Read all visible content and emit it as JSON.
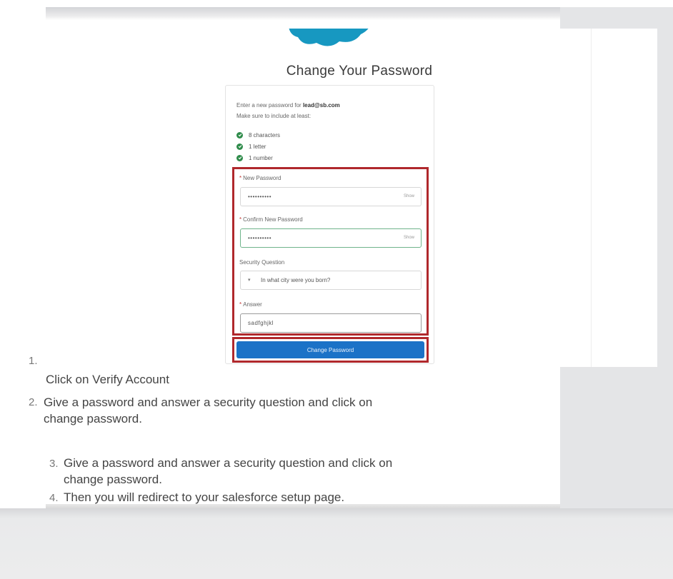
{
  "form": {
    "title": "Change Your Password",
    "intro_text": "Enter a new password for",
    "email": "lead@sb.com",
    "intro_text2": "Make sure to include at least:",
    "requirements": [
      "8 characters",
      "1 letter",
      "1 number"
    ],
    "new_password_label": "New Password",
    "new_password_value": "••••••••••",
    "show_label": "Show",
    "confirm_password_label": "Confirm New Password",
    "confirm_password_value": "••••••••••",
    "security_question_label": "Security Question",
    "security_question_value": "In what city were you born?",
    "answer_label": "Answer",
    "answer_value": "sadfghjkl",
    "submit_label": "Change Password"
  },
  "steps": [
    {
      "number": "1.",
      "text": "Click on Verify Account"
    },
    {
      "number": "2.",
      "text": "Give a password and answer a security question and click on",
      "text2": "change password."
    },
    {
      "number": "3.",
      "text": "Give a password and answer a security question and click on",
      "text2": "change password."
    },
    {
      "number": "4.",
      "text": "Then you will redirect to your salesforce setup page."
    }
  ],
  "colors": {
    "brand_cloud": "#1798c1",
    "button": "#1b72c7",
    "highlight_border": "#b0282c",
    "check_green": "#2e8b4a"
  }
}
